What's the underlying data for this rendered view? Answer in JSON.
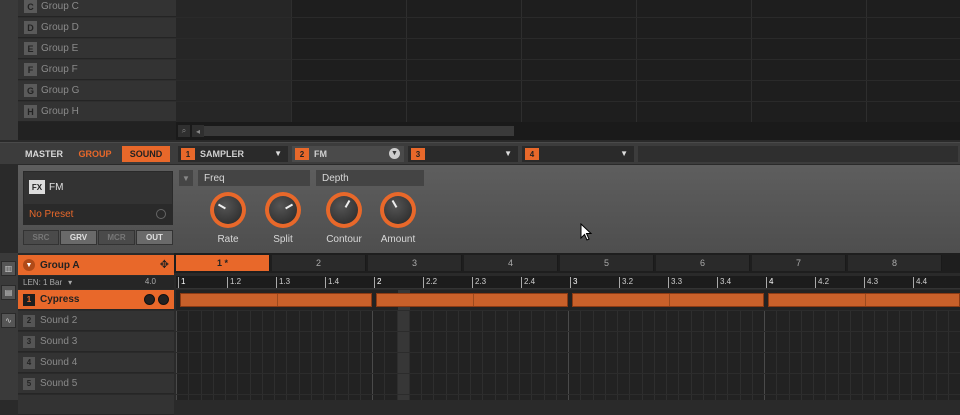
{
  "groups": [
    {
      "letter": "C",
      "name": "Group C"
    },
    {
      "letter": "D",
      "name": "Group D"
    },
    {
      "letter": "E",
      "name": "Group E"
    },
    {
      "letter": "F",
      "name": "Group F"
    },
    {
      "letter": "G",
      "name": "Group G"
    },
    {
      "letter": "H",
      "name": "Group H"
    }
  ],
  "tabs": {
    "master": "MASTER",
    "group": "GROUP",
    "sound": "SOUND"
  },
  "slots": [
    {
      "num": "1",
      "name": "SAMPLER"
    },
    {
      "num": "2",
      "name": "FM"
    },
    {
      "num": "3",
      "name": ""
    },
    {
      "num": "4",
      "name": ""
    }
  ],
  "plugin": {
    "fx_badge": "FX",
    "name": "FM",
    "preset": "No Preset"
  },
  "plugin_buttons": [
    "SRC",
    "GRV",
    "MCR",
    "OUT"
  ],
  "pages": [
    "Freq",
    "Depth"
  ],
  "knobs": [
    "Rate",
    "Split",
    "Contour",
    "Amount"
  ],
  "group_header": {
    "name": "Group A"
  },
  "length": {
    "label": "LEN: 1 Bar",
    "value": "4.0"
  },
  "sounds": [
    {
      "num": "1",
      "name": "Cypress"
    },
    {
      "num": "2",
      "name": "Sound 2"
    },
    {
      "num": "3",
      "name": "Sound 3"
    },
    {
      "num": "4",
      "name": "Sound 4"
    },
    {
      "num": "5",
      "name": "Sound 5"
    }
  ],
  "patterns": [
    "1 *",
    "2",
    "3",
    "4",
    "5",
    "6",
    "7",
    "8"
  ],
  "ruler": [
    "1",
    "1.2",
    "1.3",
    "1.4",
    "2",
    "2.2",
    "2.3",
    "2.4",
    "3",
    "3.2",
    "3.3",
    "3.4",
    "4",
    "4.2",
    "4.3",
    "4.4"
  ],
  "colors": {
    "accent": "#e8682a",
    "note": "#c8602a"
  },
  "icons": {
    "arranger_search": "search-icon",
    "scroll_left": "arrow-left-icon",
    "group_move": "move-icon",
    "tools": [
      "piano-icon",
      "keyboard-icon",
      "waveform-icon"
    ]
  }
}
